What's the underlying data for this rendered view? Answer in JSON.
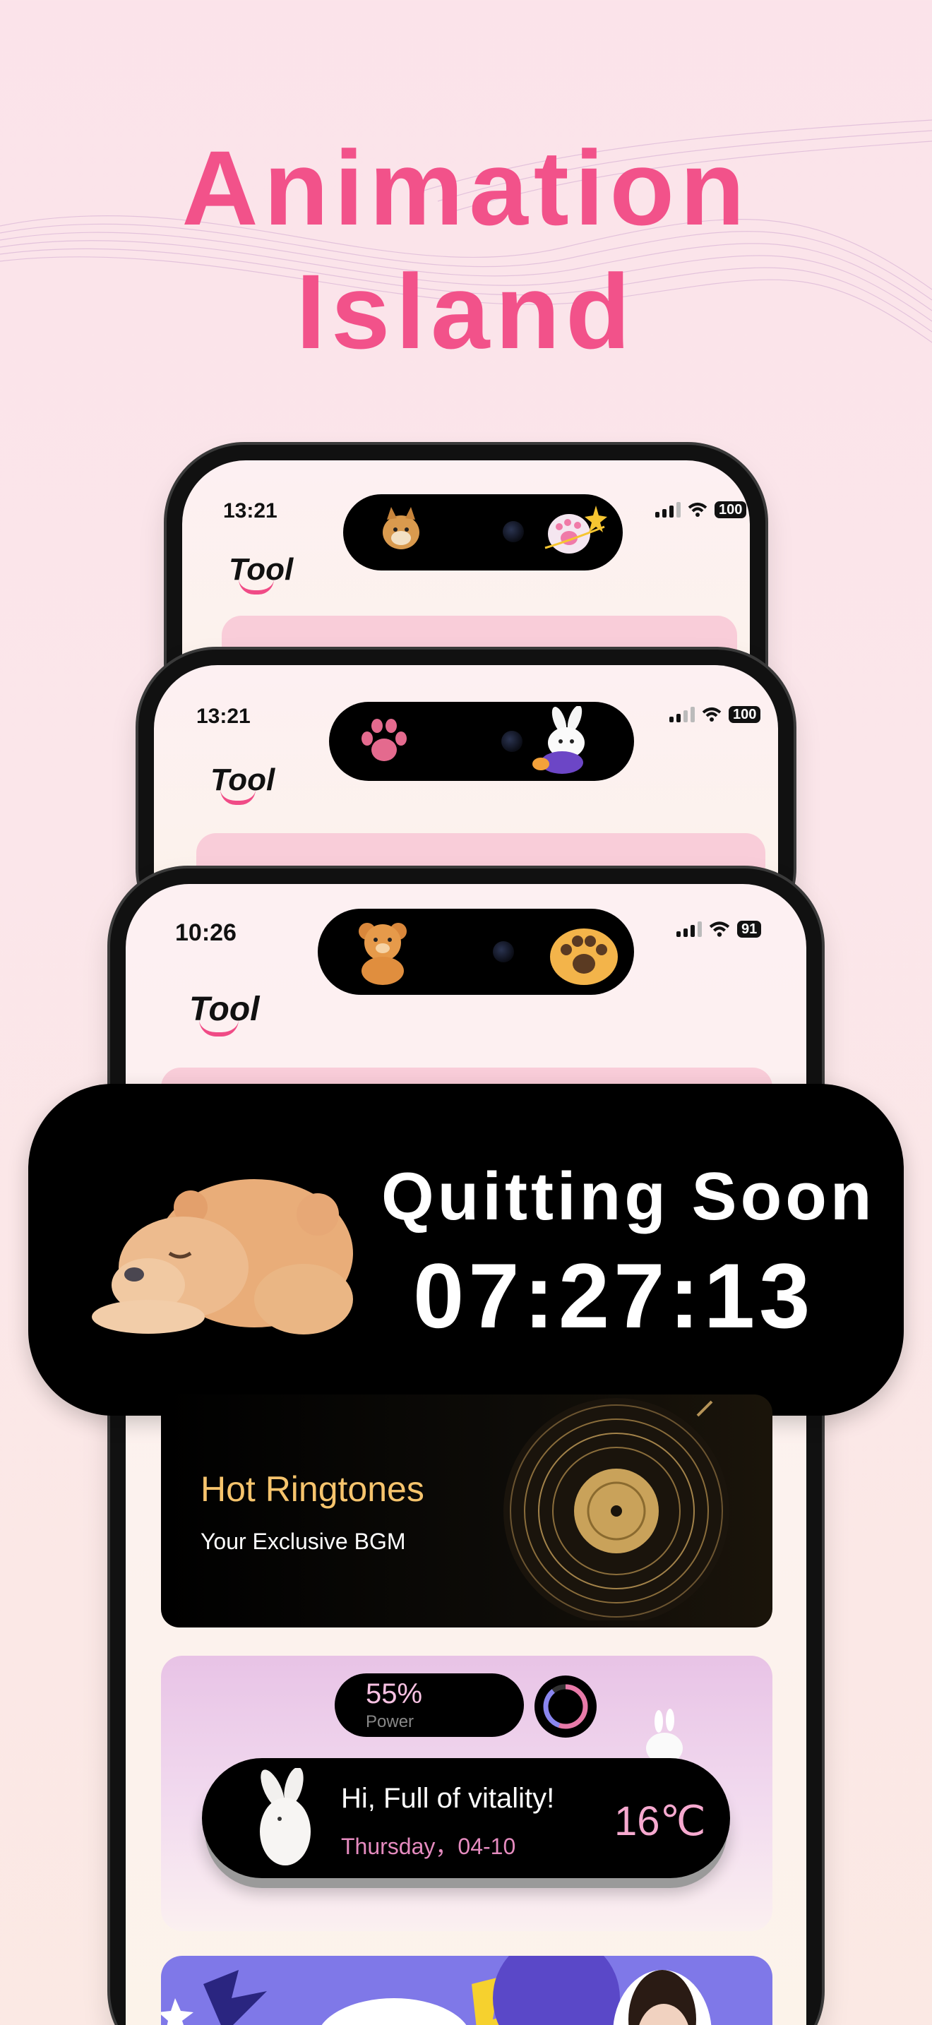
{
  "headline": {
    "line1": "Animation",
    "line2": "Island"
  },
  "phones": [
    {
      "time": "13:21",
      "battery": "100",
      "logo": "Tool"
    },
    {
      "time": "13:21",
      "battery": "100",
      "logo": "Tool"
    },
    {
      "time": "10:26",
      "battery": "91",
      "logo": "Tool"
    }
  ],
  "banner": {
    "title": "Quitting Soon",
    "countdown": "07:27:13"
  },
  "ringtones": {
    "title": "Hot Ringtones",
    "subtitle": "Your Exclusive BGM"
  },
  "widget": {
    "power_percent": "55%",
    "power_label": "Power",
    "greeting": "Hi, Full of vitality!",
    "date": "Thursday，04-10",
    "temperature": "16℃"
  },
  "colors": {
    "headline": "#f2528a",
    "ringtone_title": "#f6c46d",
    "smile": "#f04b86"
  },
  "icons": [
    "cat-icon",
    "paw-planet-icon",
    "paw-icon",
    "rabbit-icon",
    "bear-icon",
    "paw-orange-icon",
    "sleeping-bear-icon",
    "vinyl-record-icon",
    "power-ring-icon",
    "bunny-icon"
  ]
}
